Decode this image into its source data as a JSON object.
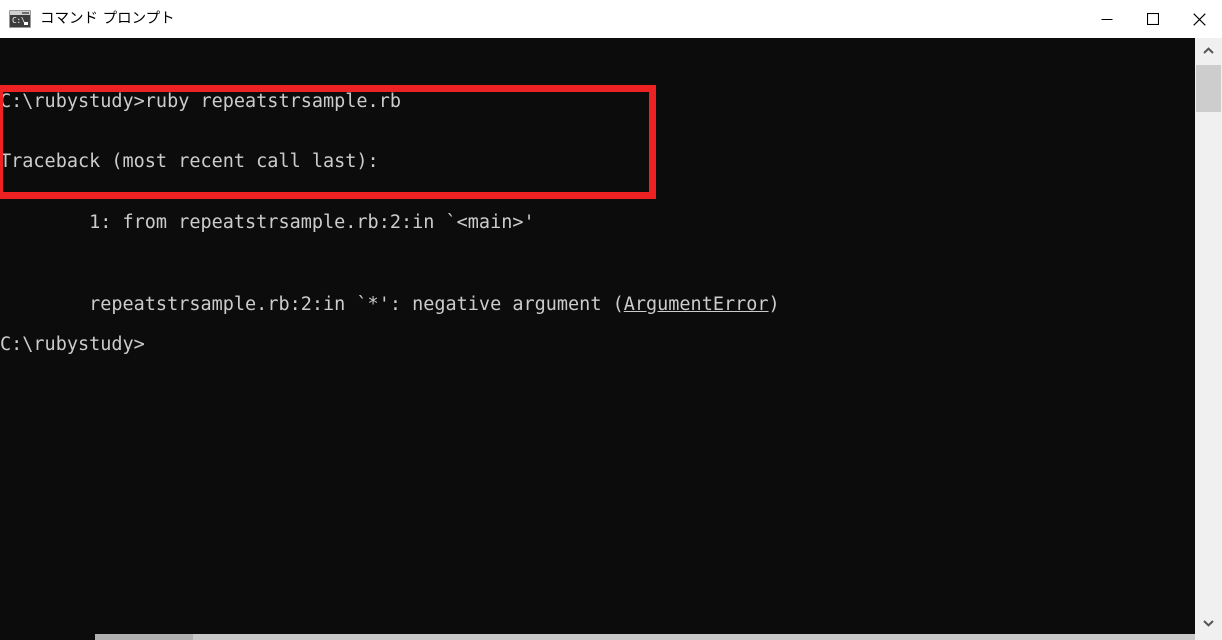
{
  "window": {
    "title": "コマンド プロンプト",
    "icon": "cmd-icon",
    "icon_label": "C:\\",
    "background_color": "#0c0c0c",
    "titlebar_color": "#ffffff",
    "text_color": "#cccccc"
  },
  "titlebar_buttons": {
    "minimize_label": "—",
    "maximize_label": "□",
    "close_label": "✕"
  },
  "console": {
    "lines": [
      "C:\\rubystudy>ruby repeatstrsample.rb",
      "Traceback (most recent call last):",
      "        1: from repeatstrsample.rb:2:in `<main>'",
      "repeatstrsample.rb:2:in `*': negative argument (",
      "C:\\rubystudy>"
    ],
    "line4_prefix": "repeatstrsample.rb:2:in `*': negative argument (",
    "line4_error": "ArgumentError",
    "line4_suffix": ")",
    "prompt": "C:\\rubystudy>"
  },
  "annotation": {
    "shape": "rectangle",
    "color": "#ee2222",
    "border_width_px": 7
  },
  "scrollbar": {
    "up_arrow": "scroll-up-arrow",
    "down_arrow": "scroll-down-arrow",
    "thumb_color": "#cdcdcd",
    "track_color": "#f0f0f0"
  }
}
